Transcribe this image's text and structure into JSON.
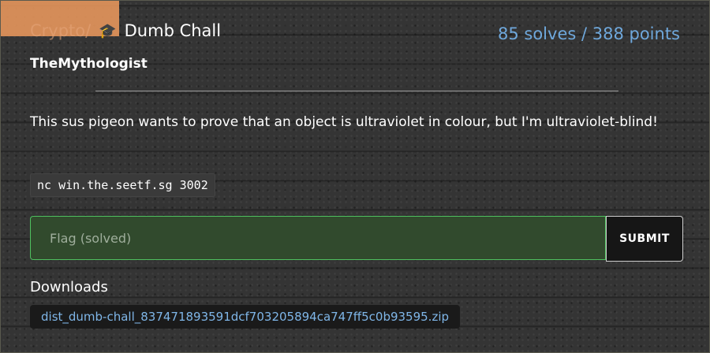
{
  "challenge": {
    "category": "Crypto/",
    "icon": "graduation-cap-icon",
    "title": "Dumb Chall",
    "solves_points": "85 solves / 388 points",
    "author": "TheMythologist",
    "description": "This sus pigeon wants to prove that an object is ultraviolet in colour, but I'm ultraviolet-blind!",
    "connection": "nc win.the.seetf.sg 3002"
  },
  "flag_form": {
    "placeholder": "Flag (solved)",
    "value": "",
    "submit_label": "SUBMIT"
  },
  "downloads": {
    "label": "Downloads",
    "files": [
      "dist_dumb-chall_837471893591dcf703205894ca747ff5c0b93595.zip"
    ]
  },
  "colors": {
    "category_tab": "#e2945b",
    "solves_text": "#6fa8dc",
    "flag_border": "#4fc160",
    "link": "#7fb6e8"
  }
}
